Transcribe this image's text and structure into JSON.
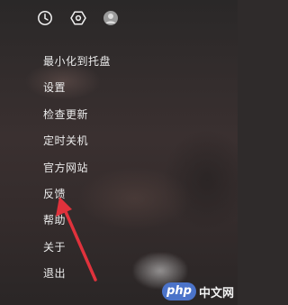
{
  "header": {
    "icons": [
      "clock-icon",
      "settings-hex-icon",
      "user-avatar"
    ]
  },
  "menu": {
    "items": [
      {
        "label": "最小化到托盘"
      },
      {
        "label": "设置"
      },
      {
        "label": "检查更新"
      },
      {
        "label": "定时关机"
      },
      {
        "label": "官方网站"
      },
      {
        "label": "反馈"
      },
      {
        "label": "帮助"
      },
      {
        "label": "关于"
      },
      {
        "label": "退出"
      }
    ]
  },
  "annotation": {
    "arrow_color": "#e0323c"
  },
  "watermark": {
    "badge": "php",
    "text": "中文网"
  }
}
